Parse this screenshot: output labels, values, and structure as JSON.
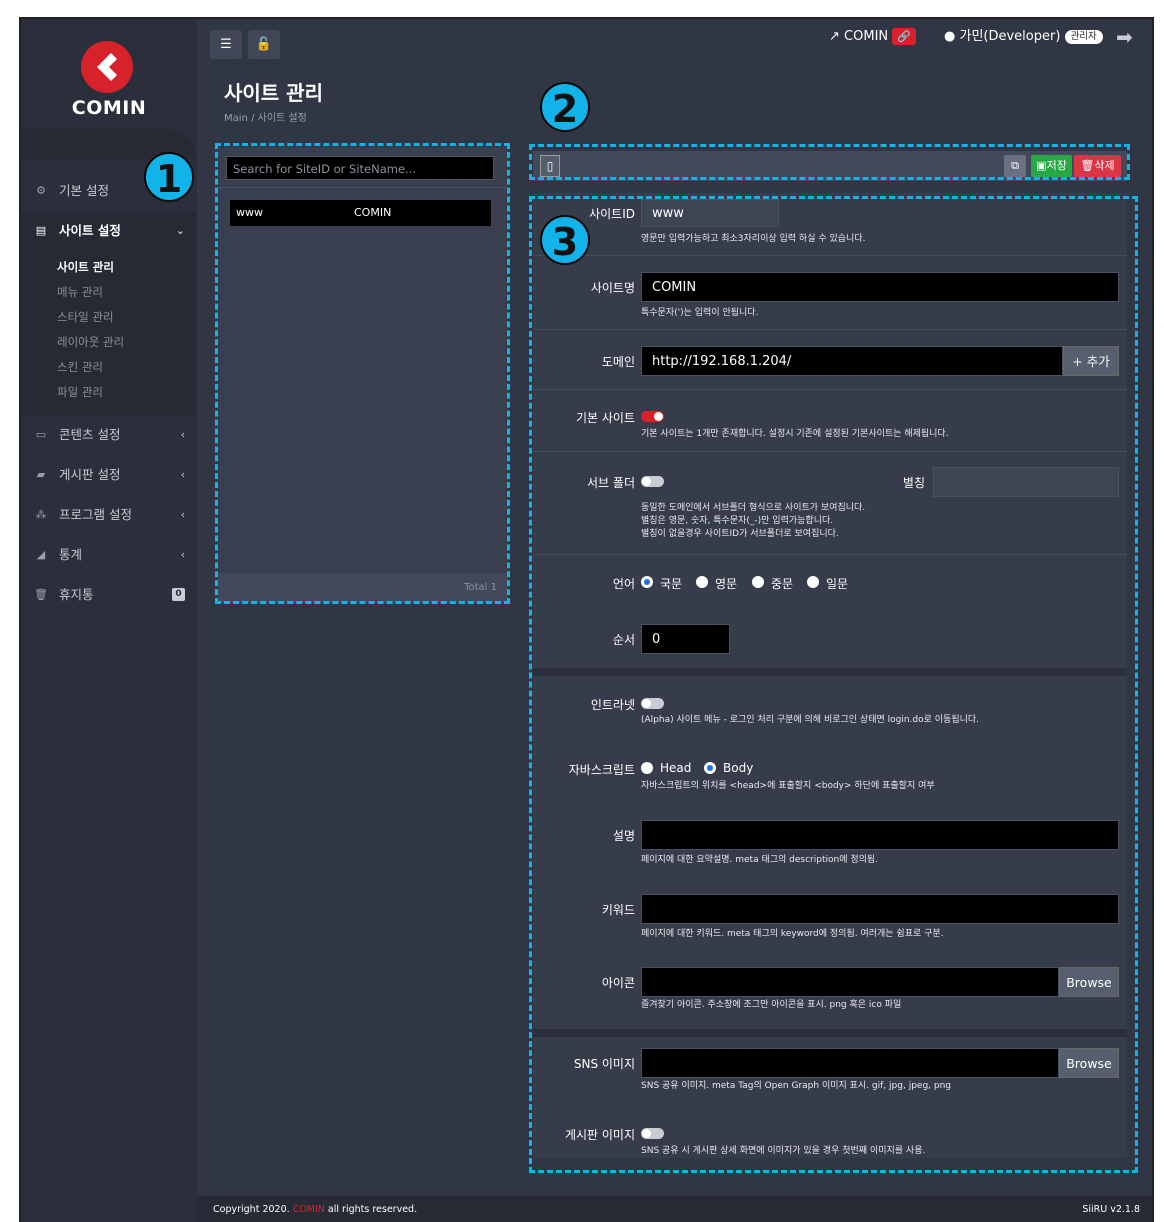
{
  "brand": {
    "name": "COMIN",
    "color": "#d8222b"
  },
  "topbar": {
    "site_link": "COMIN",
    "user": "가민(Developer)",
    "role": "관리자",
    "icons": [
      "list-icon",
      "unlock-icon",
      "external-link-icon",
      "link-icon",
      "user-icon",
      "logout-icon"
    ]
  },
  "sidebar": {
    "items": [
      {
        "label": "기본 설정",
        "icon": "gears-icon"
      },
      {
        "label": "사이트 설정",
        "icon": "server-icon"
      },
      {
        "label": "콘텐츠 설정",
        "icon": "content-icon"
      },
      {
        "label": "게시판 설정",
        "icon": "comments-icon"
      },
      {
        "label": "프로그램 설정",
        "icon": "sitemap-icon"
      },
      {
        "label": "통계",
        "icon": "chart-icon"
      },
      {
        "label": "휴지통",
        "icon": "trash-icon",
        "badge": "0"
      }
    ],
    "sub": [
      "사이트 관리",
      "메뉴 관리",
      "스타일 관리",
      "레이아웃 관리",
      "스킨 관리",
      "파일 관리"
    ]
  },
  "page": {
    "title": "사이트 관리",
    "crumb_main": "Main",
    "crumb_sep": "/",
    "crumb_current": "사이트 설정"
  },
  "markers": [
    "1",
    "2",
    "3"
  ],
  "list": {
    "search_placeholder": "Search for SiteID or SiteName...",
    "rows": [
      {
        "id": "www",
        "name": "COMIN"
      }
    ],
    "total": "Total 1"
  },
  "toolbar": {
    "save": "저장",
    "delete": "삭제"
  },
  "form": {
    "site_id": {
      "label": "사이트ID",
      "value": "www",
      "help": "영문만 입력가능하고 최소3자리이상 입력 하실 수 있습니다."
    },
    "site_name": {
      "label": "사이트명",
      "value": "COMIN",
      "help": "특수문자(')는 입력이 안됩니다."
    },
    "domain": {
      "label": "도메인",
      "value": "http://192.168.1.204/",
      "add": "+ 추가"
    },
    "default_site": {
      "label": "기본 사이트",
      "on": true,
      "help": "기본 사이트는 1개만 존재합니다. 설정시 기존에 설정된 기본사이트는 해제됩니다."
    },
    "sub_folder": {
      "label": "서브 폴더",
      "on": false,
      "alias_label": "별칭",
      "alias_value": "",
      "help": [
        "동일한 도메인에서 서브폴더 형식으로 사이트가 보여집니다.",
        "별칭은 영문, 숫자, 특수문자(_-)만 입력가능합니다.",
        "별칭이 없을경우 사이트ID가 서브폴더로 보여집니다."
      ]
    },
    "language": {
      "label": "언어",
      "options": [
        "국문",
        "영문",
        "중문",
        "일문"
      ],
      "selected": "국문"
    },
    "order": {
      "label": "순서",
      "value": "0"
    },
    "intranet": {
      "label": "인트라넷",
      "on": false,
      "help": "(Alpha) 사이트 메뉴 - 로그인 처리 구분에 의해 비로그인 상태면 login.do로 이동됩니다."
    },
    "javascript": {
      "label": "자바스크립트",
      "options": [
        "Head",
        "Body"
      ],
      "selected": "Body",
      "help": "자바스크립트의 위치를 <head>에 표출할지 <body> 하단에 표출할지 여부"
    },
    "description": {
      "label": "설명",
      "value": "",
      "help": "페이지에 대한 요약설명. meta 태그의 description에 정의됨."
    },
    "keywords": {
      "label": "키워드",
      "value": "",
      "help": "페이지에 대한 키워드. meta 태그의 keyword에 정의됨. 여러개는 쉼표로 구분."
    },
    "icon": {
      "label": "아이콘",
      "browse": "Browse",
      "help": "즐겨찾기 아이콘. 주소창에 조그만 아이콘을 표시. png 혹은 ico 파일"
    },
    "sns_image": {
      "label": "SNS 이미지",
      "browse": "Browse",
      "help": "SNS 공유 이미지. meta Tag의 Open Graph 이미지 표시. gif, jpg, jpeg, png"
    },
    "board_image": {
      "label": "게시판 이미지",
      "on": false,
      "help": "SNS 공유 시 게시판 상세 화면에 이미지가 있을 경우 첫번째 이미지를 사용."
    }
  },
  "footer": {
    "copyright_pre": "Copyright 2020.",
    "copyright_brand": "COMIN",
    "copyright_post": "all rights reserved.",
    "version": "SiiRU v2.1.8"
  }
}
